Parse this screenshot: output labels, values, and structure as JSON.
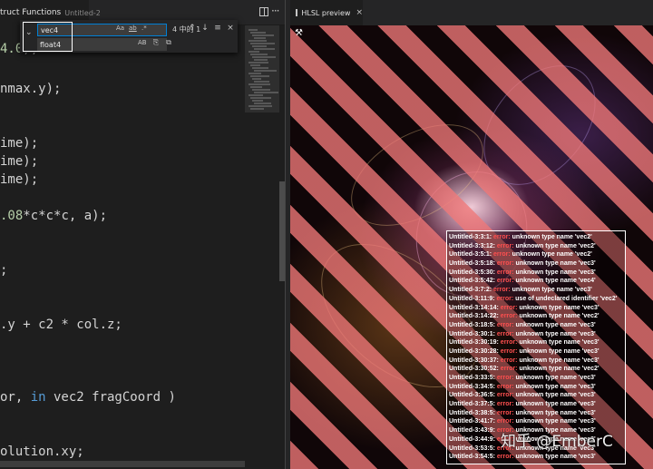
{
  "editor": {
    "tab": {
      "title": "truct Functions",
      "subtitle": "Untitled-2"
    },
    "find": {
      "search_value": "vec4",
      "replace_value": "float4",
      "opt_case": "Aa",
      "opt_word": "ab",
      "opt_regex": ".*",
      "opt_preserve_case": "AB",
      "count": "4 中的 1",
      "prev": "↑",
      "next": "↓",
      "in_selection": "≡",
      "close": "×"
    },
    "code_lines": [
      {
        "pre": "",
        "num": "4.0",
        "post": ");"
      },
      {
        "pre": "nmax.y);",
        "num": "",
        "post": ""
      },
      {
        "pre": "ime);",
        "num": "",
        "post": ""
      },
      {
        "pre": "ime);",
        "num": "",
        "post": ""
      },
      {
        "pre": "ime);",
        "num": "",
        "post": ""
      },
      {
        "pre": "",
        "num": ".08",
        "post": "*c*c*c, a);"
      },
      {
        "pre": ";",
        "num": "",
        "post": ""
      },
      {
        "pre": ".y + c2 * col.z;",
        "num": "",
        "post": ""
      },
      {
        "pre": "or, ",
        "kw": "in",
        "post": " vec2 fragCoord )"
      },
      {
        "pre": "olution.xy;",
        "num": "",
        "post": ""
      }
    ]
  },
  "preview": {
    "tab_title": "HLSL preview",
    "errors": [
      {
        "loc": "Untitled-3:3:1:",
        "kw": "error:",
        "msg": "unknown type name 'vec2'"
      },
      {
        "loc": "Untitled-3:3:12:",
        "kw": "error:",
        "msg": "unknown type name 'vec2'"
      },
      {
        "loc": "Untitled-3:5:1:",
        "kw": "error:",
        "msg": "unknown type name 'vec2'"
      },
      {
        "loc": "Untitled-3:5:18:",
        "kw": "error:",
        "msg": "unknown type name 'vec3'"
      },
      {
        "loc": "Untitled-3:5:30:",
        "kw": "error:",
        "msg": "unknown type name 'vec3'"
      },
      {
        "loc": "Untitled-3:5:42:",
        "kw": "error:",
        "msg": "unknown type name 'vec4'"
      },
      {
        "loc": "Untitled-3:7:2:",
        "kw": "error:",
        "msg": "unknown type name 'vec3'"
      },
      {
        "loc": "Untitled-3:11:9:",
        "kw": "error:",
        "msg": "use of undeclared identifier 'vec2'"
      },
      {
        "loc": "Untitled-3:14:14:",
        "kw": "error:",
        "msg": "unknown type name 'vec3'"
      },
      {
        "loc": "Untitled-3:14:22:",
        "kw": "error:",
        "msg": "unknown type name 'vec2'"
      },
      {
        "loc": "Untitled-3:18:5:",
        "kw": "error:",
        "msg": "unknown type name 'vec3'"
      },
      {
        "loc": "Untitled-3:30:1:",
        "kw": "error:",
        "msg": "unknown type name 'vec3'"
      },
      {
        "loc": "Untitled-3:30:19:",
        "kw": "error:",
        "msg": "unknown type name 'vec3'"
      },
      {
        "loc": "Untitled-3:30:28:",
        "kw": "error:",
        "msg": "unknown type name 'vec3'"
      },
      {
        "loc": "Untitled-3:30:37:",
        "kw": "error:",
        "msg": "unknown type name 'vec3'"
      },
      {
        "loc": "Untitled-3:30:52:",
        "kw": "error:",
        "msg": "unknown type name 'vec2'"
      },
      {
        "loc": "Untitled-3:33:5:",
        "kw": "error:",
        "msg": "unknown type name 'vec3'"
      },
      {
        "loc": "Untitled-3:34:5:",
        "kw": "error:",
        "msg": "unknown type name 'vec3'"
      },
      {
        "loc": "Untitled-3:36:5:",
        "kw": "error:",
        "msg": "unknown type name 'vec3'"
      },
      {
        "loc": "Untitled-3:37:5:",
        "kw": "error:",
        "msg": "unknown type name 'vec3'"
      },
      {
        "loc": "Untitled-3:38:5:",
        "kw": "error:",
        "msg": "unknown type name 'vec3'"
      },
      {
        "loc": "Untitled-3:41:7:",
        "kw": "error:",
        "msg": "unknown type name 'vec3'"
      },
      {
        "loc": "Untitled-3:43:9:",
        "kw": "error:",
        "msg": "unknown type name 'vec3'"
      },
      {
        "loc": "Untitled-3:44:9:",
        "kw": "error:",
        "msg": "unknown type name 'vec3'"
      },
      {
        "loc": "Untitled-3:53:5:",
        "kw": "error:",
        "msg": "unknown type name 'vec3'"
      },
      {
        "loc": "Untitled-3:54:5:",
        "kw": "error:",
        "msg": "unknown type name 'vec3'"
      }
    ],
    "watermark": "知乎 @EmberC"
  },
  "colors": {
    "error_keyword": "#ff4f4f",
    "stripe": "#f07878",
    "find_focus": "#007fd4"
  }
}
